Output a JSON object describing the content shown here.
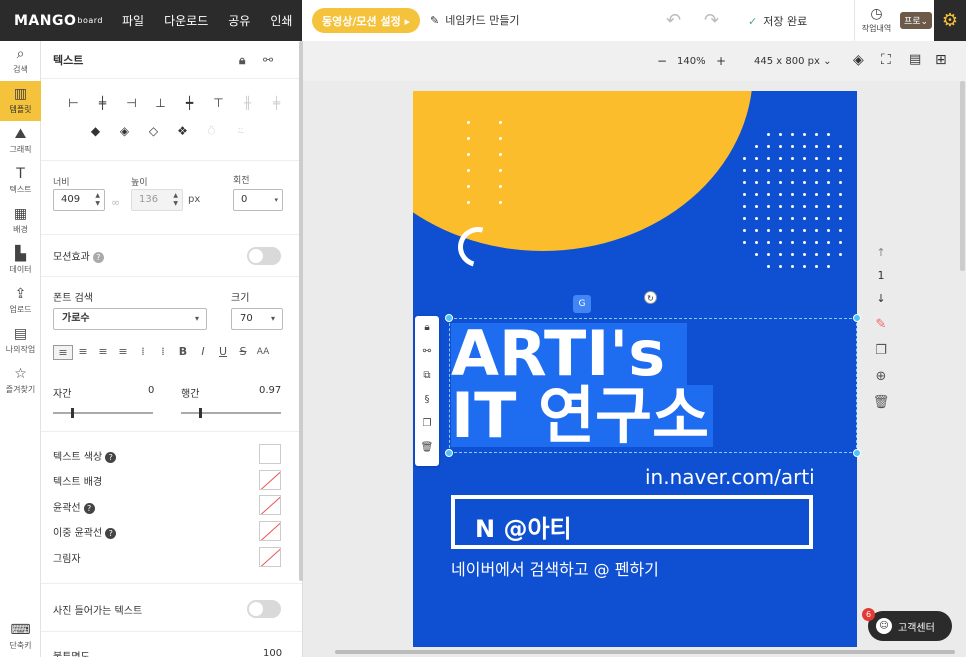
{
  "topbar": {
    "logo": "MANGO",
    "logo_sub": "board",
    "menu": [
      "파일",
      "다운로드",
      "공유",
      "인쇄"
    ],
    "motion_button": "동영상/모션 설정 ▸",
    "namecard_button": "네임카드 만들기",
    "save_status": "저장 완료",
    "history_label": "작업내역",
    "pro_badge": "프로⌄"
  },
  "leftnav": {
    "items": [
      {
        "label": "검색",
        "icon": "search-icon",
        "glyph": "⌕"
      },
      {
        "label": "템플릿",
        "icon": "template-icon",
        "glyph": "▥",
        "active": true
      },
      {
        "label": "그래픽",
        "icon": "graphic-icon",
        "glyph": "⛰"
      },
      {
        "label": "텍스트",
        "icon": "text-icon",
        "glyph": "T"
      },
      {
        "label": "배경",
        "icon": "background-icon",
        "glyph": "▦"
      },
      {
        "label": "데이터",
        "icon": "data-icon",
        "glyph": "▙"
      },
      {
        "label": "업로드",
        "icon": "upload-icon",
        "glyph": "⇪"
      },
      {
        "label": "나의작업",
        "icon": "my-work-icon",
        "glyph": "▤"
      },
      {
        "label": "즐겨찾기",
        "icon": "star-icon",
        "glyph": "☆"
      }
    ],
    "bottom": {
      "label": "단축키",
      "icon": "keyboard-icon",
      "glyph": "⌨"
    }
  },
  "panel": {
    "title": "텍스트",
    "align_row1": [
      "⊢",
      "╪",
      "⊣",
      "⊥",
      "┿",
      "⊤",
      "╫",
      "╪"
    ],
    "align_row2": [
      "◆",
      "◈",
      "◇",
      "❖",
      "⍥",
      "⍨"
    ],
    "width_label": "너비",
    "width_value": "409",
    "height_label": "높이",
    "height_value": "136",
    "unit": "px",
    "rotate_label": "회전",
    "rotate_value": "0",
    "motion_label": "모션효과",
    "font_search_label": "폰트 검색",
    "font_value": "가로수",
    "size_label": "크기",
    "size_value": "70",
    "format_buttons": [
      "≡",
      "≡",
      "≡",
      "≡",
      "⁞",
      "⁞",
      "B",
      "I",
      "U",
      "S",
      "AA"
    ],
    "spacing_label": "자간",
    "spacing_value": "0",
    "line_label": "행간",
    "line_value": "0.97",
    "text_color_label": "텍스트 색상",
    "text_bg_label": "텍스트 배경",
    "outline_label": "윤곽선",
    "double_outline_label": "이중 윤곽선",
    "shadow_label": "그림자",
    "photo_text_label": "사진 들어가는 텍스트",
    "opacity_label": "불투명도",
    "opacity_value": "100"
  },
  "zoombar": {
    "minus": "−",
    "zoom": "140%",
    "plus": "+",
    "size": "445 x 800 px ⌄"
  },
  "card": {
    "title_line1": "ARTI's",
    "title_line2": "IT 연구소",
    "url": "in.naver.com/arti",
    "box_text": "N   @아티",
    "subtitle": "네이버에서 검색하고 @ 펜하기"
  },
  "pager": {
    "up": "↑",
    "page": "1",
    "down": "↓"
  },
  "help": {
    "label": "고객센터",
    "badge": "6"
  },
  "colors": {
    "accent": "#f5c23b",
    "card_bg": "#0f4fd1",
    "blob": "#fbbd2c",
    "dark": "#2b2b2b"
  }
}
